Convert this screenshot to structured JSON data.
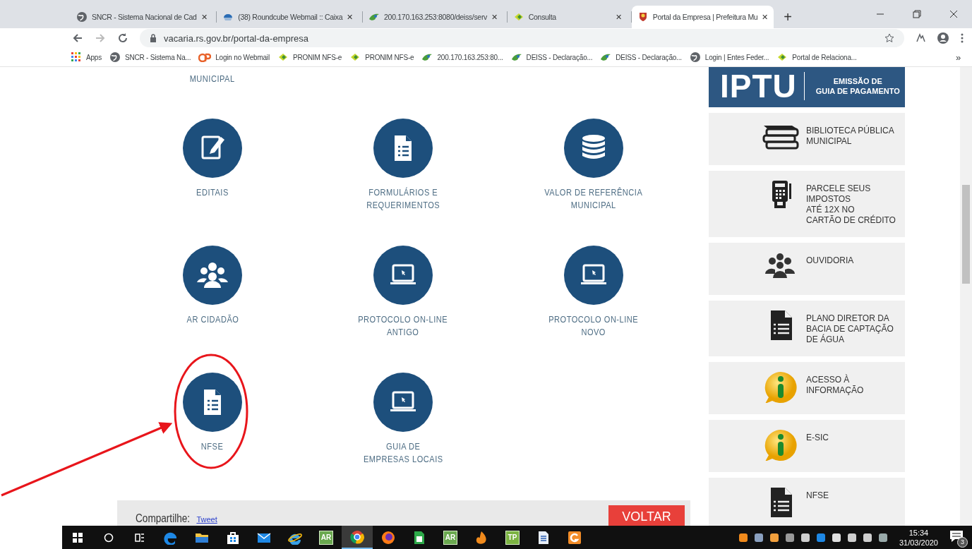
{
  "browser": {
    "tabs": [
      {
        "kind": "globe",
        "title": "SNCR - Sistema Nacional de Cad",
        "close": "✕",
        "selected": false
      },
      {
        "kind": "roundcube",
        "title": "(38) Roundcube Webmail :: Caixa",
        "close": "✕",
        "selected": false
      },
      {
        "kind": "deiss",
        "title": "200.170.163.253:8080/deiss/serv",
        "close": "✕",
        "selected": false
      },
      {
        "kind": "pronim",
        "title": "Consulta",
        "close": "✕",
        "selected": false
      },
      {
        "kind": "crest",
        "title": "Portal da Empresa | Prefeitura Mu",
        "close": "✕",
        "selected": true
      }
    ],
    "new_tab": "+",
    "address": "vacaria.rs.gov.br/portal-da-empresa",
    "bookmarks": [
      {
        "kind": "apps",
        "label": "Apps"
      },
      {
        "kind": "globe",
        "label": "SNCR - Sistema Na..."
      },
      {
        "kind": "cpanel",
        "label": "Login no Webmail"
      },
      {
        "kind": "pronim",
        "label": "PRONIM NFS-e"
      },
      {
        "kind": "pronim",
        "label": "PRONIM NFS-e"
      },
      {
        "kind": "deiss",
        "label": "200.170.163.253:80..."
      },
      {
        "kind": "deiss",
        "label": "DEISS - Declaração..."
      },
      {
        "kind": "deiss",
        "label": "DEISS - Declaração..."
      },
      {
        "kind": "globe",
        "label": "Login | Entes Feder..."
      },
      {
        "kind": "pronim",
        "label": "Portal de Relaciona..."
      }
    ],
    "bookmarks_overflow": "»"
  },
  "services": {
    "cut_labels": [
      "MUNICIPAL"
    ],
    "tiles": [
      {
        "kind": "edit",
        "label": "EDITAIS"
      },
      {
        "kind": "document",
        "label": "FORMULÁRIOS E\nREQUERIMENTOS"
      },
      {
        "kind": "coins",
        "label": "VALOR DE REFERÊNCIA\nMUNICIPAL"
      },
      {
        "kind": "people",
        "label": "AR CIDADÃO"
      },
      {
        "kind": "laptop",
        "label": "PROTOCOLO ON-LINE\nANTIGO"
      },
      {
        "kind": "laptop",
        "label": "PROTOCOLO ON-LINE\nNOVO"
      },
      {
        "kind": "document",
        "label": "NFSE"
      },
      {
        "kind": "laptop",
        "label": "GUIA DE\nEMPRESAS LOCAIS"
      }
    ]
  },
  "sidebar": {
    "banner": {
      "title": "IPTU",
      "subtitle": "EMISSÃO DE\nGUIA DE PAGAMENTO"
    },
    "cards": [
      {
        "kind": "books",
        "label": "BIBLIOTECA PÚBLICA\nMUNICIPAL"
      },
      {
        "kind": "card-machine",
        "label": "PARCELE SEUS\nIMPOSTOS\nATÉ 12X NO\nCARTÃO DE CRÉDITO"
      },
      {
        "kind": "people",
        "label": "OUVIDORIA"
      },
      {
        "kind": "document",
        "label": "PLANO DIRETOR DA\nBACIA DE CAPTAÇÃO\nDE ÁGUA"
      },
      {
        "kind": "info",
        "label": "ACESSO À\nINFORMAÇÃO"
      },
      {
        "kind": "info",
        "label": "E-SIC"
      },
      {
        "kind": "document",
        "label": "NFSE"
      }
    ]
  },
  "footer": {
    "share_label": "Compartilhe:",
    "tweet_link": "Tweet",
    "back_button": "VOLTAR"
  },
  "taskbar": {
    "apps": [
      {
        "kind": "start",
        "active": false
      },
      {
        "kind": "search",
        "active": false
      },
      {
        "kind": "taskview",
        "active": false
      },
      {
        "kind": "edge",
        "active": false
      },
      {
        "kind": "explorer",
        "active": false
      },
      {
        "kind": "store",
        "active": false
      },
      {
        "kind": "mail",
        "active": false
      },
      {
        "kind": "ie",
        "active": false
      },
      {
        "kind": "tile",
        "label": "AR",
        "color": "#6aa84f",
        "active": false
      },
      {
        "kind": "chrome",
        "active": true
      },
      {
        "kind": "firefox",
        "active": false
      },
      {
        "kind": "sheet",
        "active": false
      },
      {
        "kind": "tile",
        "label": "AR",
        "color": "#6aa84f",
        "active": false
      },
      {
        "kind": "flame",
        "active": false
      },
      {
        "kind": "tile",
        "label": "TP",
        "color": "#7cb342",
        "active": false
      },
      {
        "kind": "doc",
        "active": false
      },
      {
        "kind": "orange",
        "active": false
      }
    ],
    "time": "15:34",
    "date": "31/03/2020",
    "notifications": "3"
  }
}
